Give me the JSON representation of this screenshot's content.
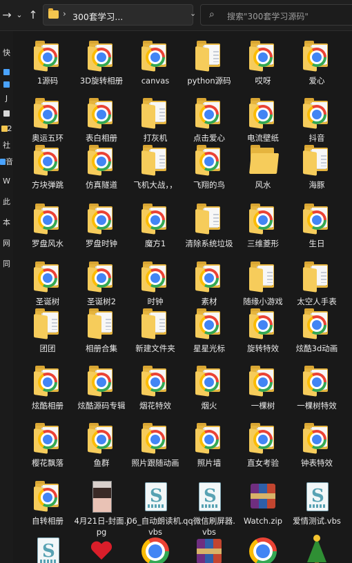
{
  "toolbar": {
    "forward_icon": "arrow-right-icon",
    "dropdown_icon": "chevron-down-icon",
    "up_icon": "arrow-up-icon",
    "address_path": "300套学习...",
    "refresh_icon": "refresh-icon",
    "search_placeholder": "搜索\"300套学习源码\""
  },
  "nav": {
    "items": [
      {
        "label": "快"
      },
      {
        "label": ""
      },
      {
        "label": ""
      },
      {
        "label": "J"
      },
      {
        "label": ""
      },
      {
        "label": "2"
      },
      {
        "label": "社"
      },
      {
        "label": "音"
      },
      {
        "label": "W"
      },
      {
        "label": "此"
      },
      {
        "label": "本"
      },
      {
        "label": "网"
      },
      {
        "label": "同"
      }
    ]
  },
  "files": [
    {
      "label": "1源码",
      "icon": "folder-chrome"
    },
    {
      "label": "3D旋转相册",
      "icon": "folder-chrome"
    },
    {
      "label": "canvas",
      "icon": "folder-chrome"
    },
    {
      "label": "python源码",
      "icon": "folder-doc"
    },
    {
      "label": "哎呀",
      "icon": "folder-chrome"
    },
    {
      "label": "爱心",
      "icon": "folder-chrome"
    },
    {
      "label": "奥运五环",
      "icon": "folder-chrome"
    },
    {
      "label": "表白相册",
      "icon": "folder-chrome"
    },
    {
      "label": "打灰机",
      "icon": "folder"
    },
    {
      "label": "点击爱心",
      "icon": "folder-chrome"
    },
    {
      "label": "电流壁纸",
      "icon": "folder-chrome"
    },
    {
      "label": "抖音",
      "icon": "folder-chrome"
    },
    {
      "label": "方块弹跳",
      "icon": "folder-chrome"
    },
    {
      "label": "仿真隧道",
      "icon": "folder-chrome"
    },
    {
      "label": "飞机大战，，",
      "icon": "folder"
    },
    {
      "label": "飞翔的鸟",
      "icon": "folder-chrome"
    },
    {
      "label": "风水",
      "icon": "folder-plain"
    },
    {
      "label": "海豚",
      "icon": "folder-doc"
    },
    {
      "label": "罗盘风水",
      "icon": "folder-chrome"
    },
    {
      "label": "罗盘时钟",
      "icon": "folder-chrome"
    },
    {
      "label": "魔方1",
      "icon": "folder-chrome"
    },
    {
      "label": "清除系统垃圾",
      "icon": "folder-doc"
    },
    {
      "label": "三维菱形",
      "icon": "folder-chrome"
    },
    {
      "label": "生日",
      "icon": "folder-chrome"
    },
    {
      "label": "圣诞树",
      "icon": "folder-chrome"
    },
    {
      "label": "圣诞树2",
      "icon": "folder-chrome"
    },
    {
      "label": "时钟",
      "icon": "folder-chrome"
    },
    {
      "label": "素材",
      "icon": "folder-chrome"
    },
    {
      "label": "随缘小游戏",
      "icon": "folder-doc"
    },
    {
      "label": "太空人手表",
      "icon": "folder"
    },
    {
      "label": "团团",
      "icon": "folder-doc"
    },
    {
      "label": "相册合集",
      "icon": "folder"
    },
    {
      "label": "新建文件夹",
      "icon": "folder"
    },
    {
      "label": "星星光标",
      "icon": "folder-chrome"
    },
    {
      "label": "旋转特效",
      "icon": "folder-chrome"
    },
    {
      "label": "炫酷3d动画",
      "icon": "folder-chrome"
    },
    {
      "label": "炫酷相册",
      "icon": "folder-chrome"
    },
    {
      "label": "炫酷源码专辑",
      "icon": "folder-chrome"
    },
    {
      "label": "烟花特效",
      "icon": "folder-chrome"
    },
    {
      "label": "烟火",
      "icon": "folder-chrome"
    },
    {
      "label": "一棵树",
      "icon": "folder-chrome"
    },
    {
      "label": "一棵树特效",
      "icon": "folder-chrome"
    },
    {
      "label": "樱花飘落",
      "icon": "folder-chrome"
    },
    {
      "label": "鱼群",
      "icon": "folder-chrome"
    },
    {
      "label": "照片跟随动画",
      "icon": "folder-chrome"
    },
    {
      "label": "照片墙",
      "icon": "folder-chrome"
    },
    {
      "label": "直女考验",
      "icon": "folder-chrome"
    },
    {
      "label": "钟表特效",
      "icon": "folder-chrome"
    },
    {
      "label": "自转相册",
      "icon": "folder-chrome"
    },
    {
      "label": "4月21日-封面.jpg",
      "icon": "photo"
    },
    {
      "label": "06_自动朗读机.vbs",
      "icon": "vbs"
    },
    {
      "label": "qq微信刷屏器.vbs",
      "icon": "vbs"
    },
    {
      "label": "Watch.zip",
      "icon": "zip"
    },
    {
      "label": "爱情测试.vbs",
      "icon": "vbs"
    },
    {
      "label": "",
      "icon": "vbs"
    },
    {
      "label": "",
      "icon": "heart"
    },
    {
      "label": "",
      "icon": "chrome"
    },
    {
      "label": "",
      "icon": "zip"
    },
    {
      "label": "",
      "icon": "chrome"
    },
    {
      "label": "",
      "icon": "tree"
    }
  ]
}
